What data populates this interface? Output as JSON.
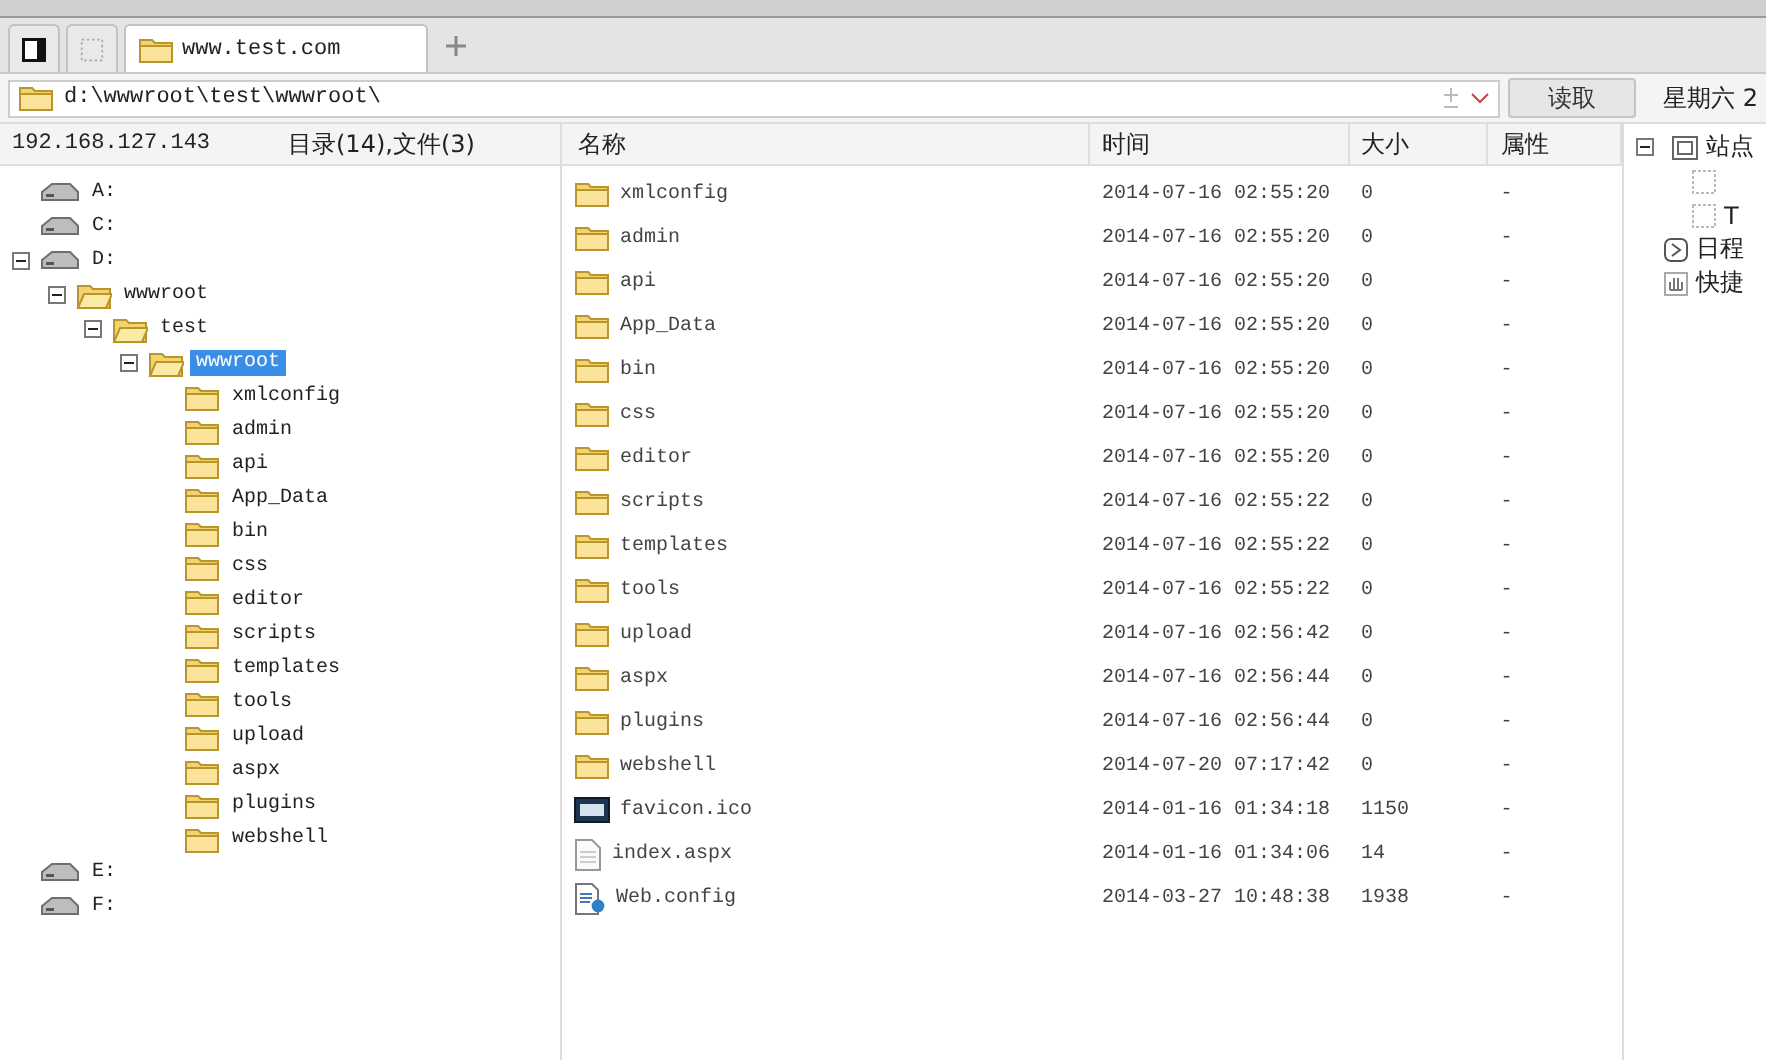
{
  "tabs": [
    {
      "kind": "panel",
      "selected": false
    },
    {
      "kind": "blank",
      "selected": false
    },
    {
      "kind": "site",
      "label": "www.test.com",
      "selected": true
    }
  ],
  "address": {
    "value": "d:\\wwwroot\\test\\wwwroot\\",
    "button": "读取"
  },
  "left_header": {
    "host": "192.168.127.143",
    "counts": "目录(14),文件(3)"
  },
  "tree": [
    {
      "label": "A:",
      "kind": "drive",
      "selected": false
    },
    {
      "label": "C:",
      "kind": "drive",
      "selected": false
    },
    {
      "label": "D:",
      "kind": "drive",
      "expanded": true,
      "selected": false,
      "children": [
        {
          "label": "wwwroot",
          "kind": "folder",
          "expanded": true,
          "selected": false,
          "children": [
            {
              "label": "test",
              "kind": "folder",
              "expanded": true,
              "selected": false,
              "children": [
                {
                  "label": "wwwroot",
                  "kind": "folder",
                  "expanded": true,
                  "selected": true,
                  "children": [
                    {
                      "label": "xmlconfig",
                      "kind": "folder",
                      "selected": false
                    },
                    {
                      "label": "admin",
                      "kind": "folder",
                      "selected": false
                    },
                    {
                      "label": "api",
                      "kind": "folder",
                      "selected": false
                    },
                    {
                      "label": "App_Data",
                      "kind": "folder",
                      "selected": false
                    },
                    {
                      "label": "bin",
                      "kind": "folder",
                      "selected": false
                    },
                    {
                      "label": "css",
                      "kind": "folder",
                      "selected": false
                    },
                    {
                      "label": "editor",
                      "kind": "folder",
                      "selected": false
                    },
                    {
                      "label": "scripts",
                      "kind": "folder",
                      "selected": false
                    },
                    {
                      "label": "templates",
                      "kind": "folder",
                      "selected": false
                    },
                    {
                      "label": "tools",
                      "kind": "folder",
                      "selected": false
                    },
                    {
                      "label": "upload",
                      "kind": "folder",
                      "selected": false
                    },
                    {
                      "label": "aspx",
                      "kind": "folder",
                      "selected": false
                    },
                    {
                      "label": "plugins",
                      "kind": "folder",
                      "selected": false
                    },
                    {
                      "label": "webshell",
                      "kind": "folder",
                      "selected": false
                    }
                  ]
                }
              ]
            }
          ]
        }
      ]
    },
    {
      "label": "E:",
      "kind": "drive",
      "selected": false
    },
    {
      "label": "F:",
      "kind": "drive",
      "selected": false
    }
  ],
  "table": {
    "columns": [
      "名称",
      "时间",
      "大小",
      "属性"
    ],
    "rows": [
      {
        "kind": "folder",
        "name": "xmlconfig",
        "time": "2014-07-16 02:55:20",
        "size": "0",
        "attr": "-"
      },
      {
        "kind": "folder",
        "name": "admin",
        "time": "2014-07-16 02:55:20",
        "size": "0",
        "attr": "-"
      },
      {
        "kind": "folder",
        "name": "api",
        "time": "2014-07-16 02:55:20",
        "size": "0",
        "attr": "-"
      },
      {
        "kind": "folder",
        "name": "App_Data",
        "time": "2014-07-16 02:55:20",
        "size": "0",
        "attr": "-"
      },
      {
        "kind": "folder",
        "name": "bin",
        "time": "2014-07-16 02:55:20",
        "size": "0",
        "attr": "-"
      },
      {
        "kind": "folder",
        "name": "css",
        "time": "2014-07-16 02:55:20",
        "size": "0",
        "attr": "-"
      },
      {
        "kind": "folder",
        "name": "editor",
        "time": "2014-07-16 02:55:20",
        "size": "0",
        "attr": "-"
      },
      {
        "kind": "folder",
        "name": "scripts",
        "time": "2014-07-16 02:55:22",
        "size": "0",
        "attr": "-"
      },
      {
        "kind": "folder",
        "name": "templates",
        "time": "2014-07-16 02:55:22",
        "size": "0",
        "attr": "-"
      },
      {
        "kind": "folder",
        "name": "tools",
        "time": "2014-07-16 02:55:22",
        "size": "0",
        "attr": "-"
      },
      {
        "kind": "folder",
        "name": "upload",
        "time": "2014-07-16 02:56:42",
        "size": "0",
        "attr": "-"
      },
      {
        "kind": "folder",
        "name": "aspx",
        "time": "2014-07-16 02:56:44",
        "size": "0",
        "attr": "-"
      },
      {
        "kind": "folder",
        "name": "plugins",
        "time": "2014-07-16 02:56:44",
        "size": "0",
        "attr": "-"
      },
      {
        "kind": "folder",
        "name": "webshell",
        "time": "2014-07-20 07:17:42",
        "size": "0",
        "attr": "-"
      },
      {
        "kind": "image",
        "name": "favicon.ico",
        "time": "2014-01-16 01:34:18",
        "size": "1150",
        "attr": "-"
      },
      {
        "kind": "document",
        "name": "index.aspx",
        "time": "2014-01-16 01:34:06",
        "size": "14",
        "attr": "-"
      },
      {
        "kind": "config",
        "name": "Web.config",
        "time": "2014-03-27 10:48:38",
        "size": "1938",
        "attr": "-"
      }
    ]
  },
  "side": {
    "date": "星期六 2",
    "items": [
      {
        "kind": "group",
        "label": "站点",
        "expanded": true
      },
      {
        "kind": "entry"
      },
      {
        "kind": "entry",
        "label": "T"
      },
      {
        "kind": "schedule",
        "label": "日程"
      },
      {
        "kind": "shortcut",
        "label": "快捷"
      }
    ]
  }
}
